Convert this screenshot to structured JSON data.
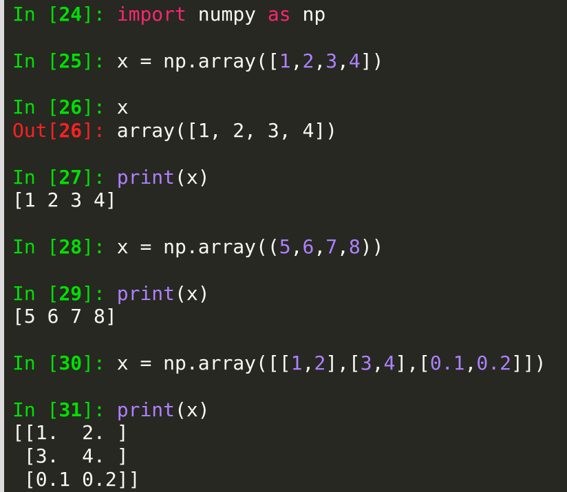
{
  "prompts": {
    "in_open": "In [",
    "out_open": "Out[",
    "close": "]",
    "sep": ": "
  },
  "cells": [
    {
      "n": "24",
      "code": [
        [
          "kw",
          "import"
        ],
        [
          "plain",
          " numpy "
        ],
        [
          "kw",
          "as"
        ],
        [
          "plain",
          " np"
        ]
      ]
    },
    {
      "n": "25",
      "code": [
        [
          "plain",
          "x = np.array(["
        ],
        [
          "num",
          "1"
        ],
        [
          "plain",
          ","
        ],
        [
          "num",
          "2"
        ],
        [
          "plain",
          ","
        ],
        [
          "num",
          "3"
        ],
        [
          "plain",
          ","
        ],
        [
          "num",
          "4"
        ],
        [
          "plain",
          "])"
        ]
      ]
    },
    {
      "n": "26",
      "code": [
        [
          "plain",
          "x"
        ]
      ],
      "out": "array([1, 2, 3, 4])"
    },
    {
      "n": "27",
      "code": [
        [
          "builtin",
          "print"
        ],
        [
          "plain",
          "(x)"
        ]
      ],
      "stdout": [
        "[1 2 3 4]"
      ]
    },
    {
      "n": "28",
      "code": [
        [
          "plain",
          "x = np.array(("
        ],
        [
          "num",
          "5"
        ],
        [
          "plain",
          ","
        ],
        [
          "num",
          "6"
        ],
        [
          "plain",
          ","
        ],
        [
          "num",
          "7"
        ],
        [
          "plain",
          ","
        ],
        [
          "num",
          "8"
        ],
        [
          "plain",
          "))"
        ]
      ]
    },
    {
      "n": "29",
      "code": [
        [
          "builtin",
          "print"
        ],
        [
          "plain",
          "(x)"
        ]
      ],
      "stdout": [
        "[5 6 7 8]"
      ]
    },
    {
      "n": "30",
      "code": [
        [
          "plain",
          "x = np.array([["
        ],
        [
          "num",
          "1"
        ],
        [
          "plain",
          ","
        ],
        [
          "num",
          "2"
        ],
        [
          "plain",
          "],["
        ],
        [
          "num",
          "3"
        ],
        [
          "plain",
          ","
        ],
        [
          "num",
          "4"
        ],
        [
          "plain",
          "],["
        ],
        [
          "num",
          "0.1"
        ],
        [
          "plain",
          ","
        ],
        [
          "num",
          "0.2"
        ],
        [
          "plain",
          "]])"
        ]
      ]
    },
    {
      "n": "31",
      "code": [
        [
          "builtin",
          "print"
        ],
        [
          "plain",
          "(x)"
        ]
      ],
      "stdout": [
        "[[1.  2. ]",
        " [3.  4. ]",
        " [0.1 0.2]]"
      ]
    }
  ]
}
